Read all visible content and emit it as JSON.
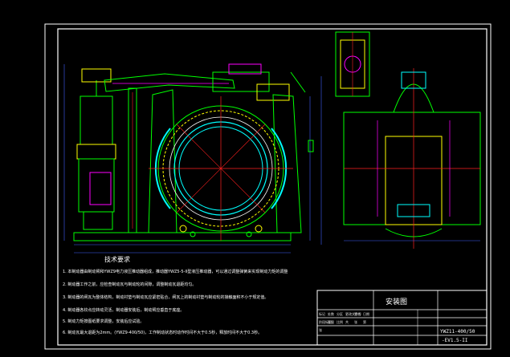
{
  "notes": {
    "heading": "技术要求",
    "lines": [
      "1. 本制动器由制动臂和YWZ9电力液压推动器组成，推动器YWZ5-5-II型液压推动器，可以通过调整弹簧来实现制动力矩的调整",
      "2. 制动器工作之前，应检查制动瓦与制动轮的间隙，调整制动瓦退距均匀。",
      "3. 制动器的闸瓦为整体结构，制动衬垫与制动瓦应紧密贴合，闸瓦上的制动衬垫与制动轮的接触面积不小于规定值。",
      "4. 制动器各铰点应转动灵活，制动器安装后，制动臂应垂直于底座。",
      "5. 制动力矩按图纸要求调整，安装后应试验。",
      "6. 制动瓦最大退距为2mm。(YWZ9-400/50)，工作制动状态时动作时间不大于0.5秒，释放时间不大于0.3秒。"
    ]
  },
  "title_block": {
    "drawing_title": "安装图",
    "model": "YWZ11-400/50",
    "sub_model": "-EV1.5-II",
    "cells": [
      "标记",
      "处数",
      "分区",
      "更改文件号",
      "签名",
      "日期",
      "阶段标记",
      "重量",
      "比例",
      "共",
      "张",
      "第",
      "张"
    ]
  },
  "colors": {
    "background": "#000000",
    "frame": "#ffffff",
    "outline": "#00ff00",
    "hub": "#00ffff",
    "center": "#ff2020",
    "detail": "#ffff00",
    "accent": "#ff00ff",
    "dim": "#4060ff"
  }
}
